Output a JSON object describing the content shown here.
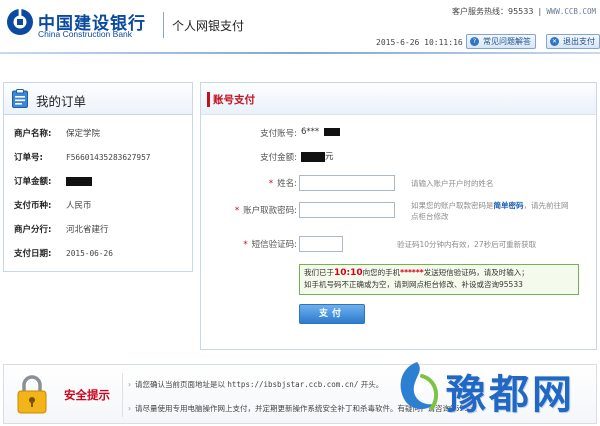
{
  "header": {
    "bank_name_cn": "中国建设银行",
    "bank_name_en": "China Construction Bank",
    "subtitle": "个人网银支付",
    "hotline_label": "客户服务热线：",
    "hotline_number": "95533",
    "hotline_url": "WWW.CCB.COM",
    "datetime": "2015-6-26 10:11:16",
    "faq_button": "常见问题解答",
    "exit_button": "退出支付"
  },
  "order": {
    "title": "我的订单",
    "rows": [
      {
        "label": "商户名称:",
        "value": "保定学院"
      },
      {
        "label": "订单号:",
        "value": "F56601435283627957"
      },
      {
        "label": "订单金额:",
        "value": ""
      },
      {
        "label": "支付币种:",
        "value": "人民币"
      },
      {
        "label": "商户分行:",
        "value": "河北省建行"
      },
      {
        "label": "支付日期:",
        "value": "2015-06-26"
      }
    ]
  },
  "payment": {
    "title": "账号支付",
    "account_label": "支付账号:",
    "account_value": "6***",
    "amount_label": "支付金额:",
    "amount_unit": "元",
    "name_label": "姓名:",
    "name_hint": "请输入账户开户时的姓名",
    "pwd_label": "账户取款密码:",
    "pwd_hint_1": "如果您的账户取款密码是",
    "pwd_hint_bold": "简单密码",
    "pwd_hint_2": "，请先前往网",
    "pwd_hint_3": "点柜台修改",
    "sms_label": "短信验证码:",
    "sms_hint": "验证码10分钟内有效，27秒后可重新获取",
    "notice_1a": "我们已于",
    "notice_time": "10:10",
    "notice_1b": "向您的手机",
    "notice_mask": "******",
    "notice_1c": "发送短信验证码，请及时输入；",
    "notice_2": "如手机号码不正确或为空，请到网点柜台修改、补设或咨询95533",
    "pay_button": "支付"
  },
  "footer": {
    "title": "安全提示",
    "tip1_a": "请您确认当前页面地址是以",
    "tip1_url": "https://ibsbjstar.ccb.com.cn/",
    "tip1_b": "开头。",
    "tip2": "请尽量使用专用电脑操作网上支付，并定期更新操作系统安全补丁和杀毒软件。有疑问，请咨询95533。"
  },
  "watermark": {
    "text": "豫都网"
  },
  "colors": {
    "brand_blue": "#0b4aa0",
    "accent_red": "#c1121f",
    "notice_green": "#74b24d",
    "button_blue": "#2c7bcf"
  }
}
